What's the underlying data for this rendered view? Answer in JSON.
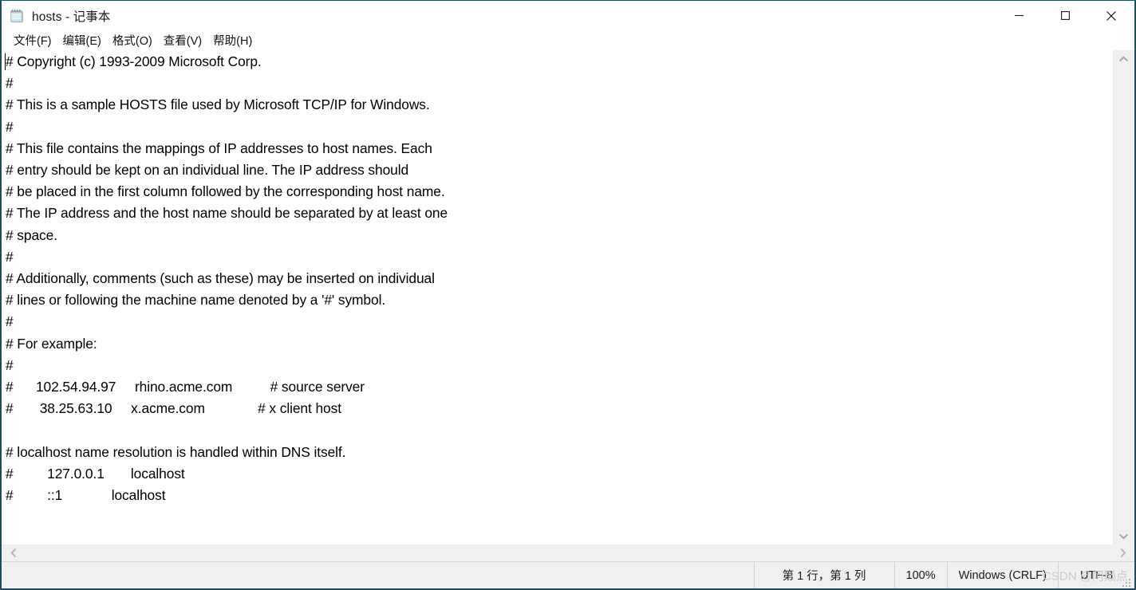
{
  "window": {
    "title": "hosts - 记事本",
    "icon": "notepad-icon",
    "border_color": "#1c4c61",
    "controls": {
      "minimize": "minimize-icon",
      "maximize": "maximize-icon",
      "close": "close-icon"
    }
  },
  "menubar": {
    "items": [
      {
        "label": "文件(F)"
      },
      {
        "label": "编辑(E)"
      },
      {
        "label": "格式(O)"
      },
      {
        "label": "查看(V)"
      },
      {
        "label": "帮助(H)"
      }
    ]
  },
  "editor": {
    "text": "# Copyright (c) 1993-2009 Microsoft Corp.\n#\n# This is a sample HOSTS file used by Microsoft TCP/IP for Windows.\n#\n# This file contains the mappings of IP addresses to host names. Each\n# entry should be kept on an individual line. The IP address should\n# be placed in the first column followed by the corresponding host name.\n# The IP address and the host name should be separated by at least one\n# space.\n#\n# Additionally, comments (such as these) may be inserted on individual\n# lines or following the machine name denoted by a '#' symbol.\n#\n# For example:\n#\n#      102.54.94.97     rhino.acme.com          # source server\n#       38.25.63.10     x.acme.com              # x client host\n\n# localhost name resolution is handled within DNS itself.\n#         127.0.0.1       localhost\n#         ::1             localhost",
    "lines": [
      "# Copyright (c) 1993-2009 Microsoft Corp.",
      "#",
      "# This is a sample HOSTS file used by Microsoft TCP/IP for Windows.",
      "#",
      "# This file contains the mappings of IP addresses to host names. Each",
      "# entry should be kept on an individual line. The IP address should",
      "# be placed in the first column followed by the corresponding host name.",
      "# The IP address and the host name should be separated by at least one",
      "# space.",
      "#",
      "# Additionally, comments (such as these) may be inserted on individual",
      "# lines or following the machine name denoted by a '#' symbol.",
      "#",
      "# For example:",
      "#",
      "#      102.54.94.97     rhino.acme.com          # source server",
      "#       38.25.63.10     x.acme.com              # x client host",
      "",
      "# localhost name resolution is handled within DNS itself.",
      "#         127.0.0.1       localhost",
      "#         ::1             localhost"
    ]
  },
  "scrollbars": {
    "vertical": {
      "up_arrow": "chevron-up-icon",
      "down_arrow": "chevron-down-icon"
    },
    "horizontal": {
      "left_arrow": "chevron-left-icon",
      "right_arrow": "chevron-right-icon"
    }
  },
  "statusbar": {
    "line_column": "第 1 行，第 1 列",
    "zoom": "100%",
    "line_ending": "Windows (CRLF)",
    "encoding": "UTF-8",
    "watermark": "CSDN @阿颠点"
  }
}
